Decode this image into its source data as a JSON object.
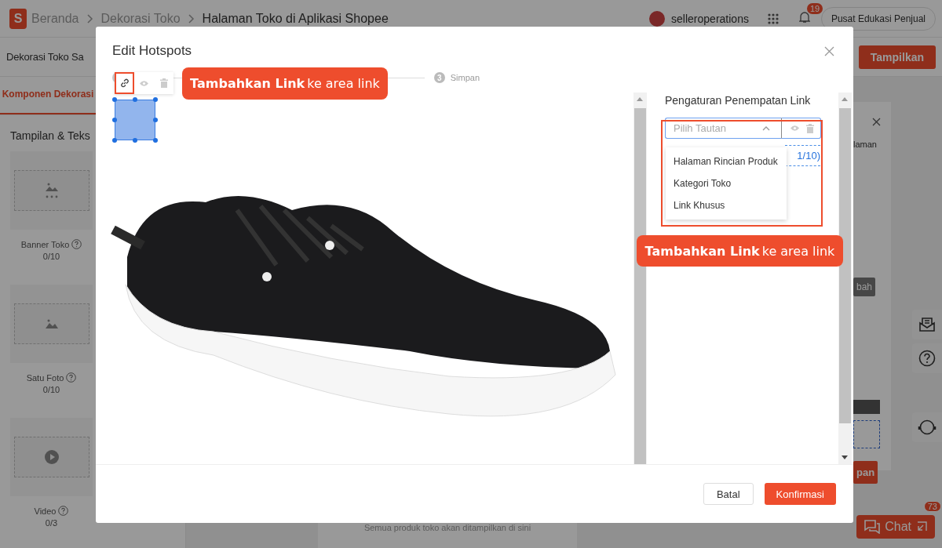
{
  "topbar": {
    "logo_letter": "S",
    "breadcrumbs": [
      {
        "label": "Beranda",
        "current": false
      },
      {
        "label": "Dekorasi Toko",
        "current": false
      },
      {
        "label": "Halaman Toko di Aplikasi Shopee",
        "current": true
      }
    ],
    "username": "selleroperations",
    "notification_count": "19",
    "help_button": "Pusat Edukasi Penjual"
  },
  "subbar": {
    "title": "Dekorasi Toko Sa",
    "publish_button": "Tampilkan"
  },
  "sidebar": {
    "tabs": [
      {
        "label": "Komponen Dekorasi",
        "selected": true
      }
    ],
    "section_title": "Tampilan & Teks",
    "items": [
      {
        "kind": "banner",
        "label": "Banner Toko",
        "count": "0/10"
      },
      {
        "kind": "photo",
        "label": "Satu Foto",
        "count": "0/10"
      },
      {
        "kind": "video",
        "label": "Video",
        "count": "0/3"
      }
    ]
  },
  "canvas": {
    "empty_text": "Semua produk toko akan ditampilkan di sini"
  },
  "side_panel": {
    "text": "laman",
    "button_1": "bah",
    "button_2": "pan"
  },
  "chat": {
    "label": "Chat",
    "badge": "73"
  },
  "modal": {
    "title": "Edit Hotspots",
    "steps": [
      {
        "number": "3",
        "label": "Simpan"
      }
    ],
    "toolbar": [
      {
        "kind": "link",
        "selected": true
      },
      {
        "kind": "preview",
        "selected": false
      },
      {
        "kind": "delete",
        "selected": false
      }
    ],
    "callouts": [
      "**Tambahkan Link** ke area link",
      "**Tambahkan Link** ke area link"
    ],
    "link_panel": {
      "title": "Pengaturan Penempatan Link",
      "select": {
        "placeholder": "Pilih Tautan",
        "expanded": true
      },
      "options": [
        "Halaman Rincian Produk",
        "Kategori Toko",
        "Link Khusus"
      ],
      "counter": "1/10)"
    },
    "buttons": [
      {
        "kind": "secondary",
        "label": "Batal"
      },
      {
        "kind": "primary",
        "label": "Konfirmasi"
      }
    ]
  }
}
